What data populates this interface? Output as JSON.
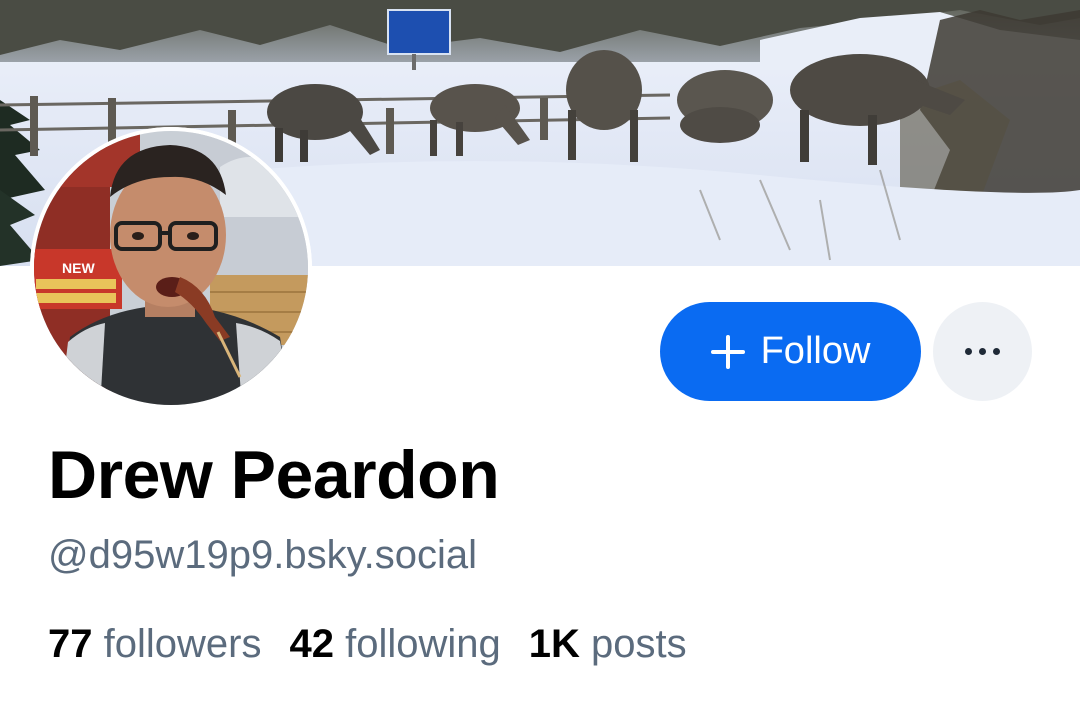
{
  "profile": {
    "display_name": "Drew Peardon",
    "handle": "@d95w19p9.bsky.social",
    "banner_image": "Elk grazing in a snowy field beside a fence and highway sign",
    "avatar_image": "Man with glasses eating a chicken foot skewer",
    "avatar_sign_text": "NEW",
    "stats": [
      {
        "value": "77",
        "label": "followers"
      },
      {
        "value": "42",
        "label": "following"
      },
      {
        "value": "1K",
        "label": "posts"
      }
    ]
  },
  "actions": {
    "follow_label": "Follow",
    "follow_icon": "plus-icon",
    "more_icon": "more-dots-icon"
  },
  "colors": {
    "accent": "#0a6bf2",
    "secondary_text": "#5b6b7d",
    "more_button_bg": "#eef1f5"
  }
}
